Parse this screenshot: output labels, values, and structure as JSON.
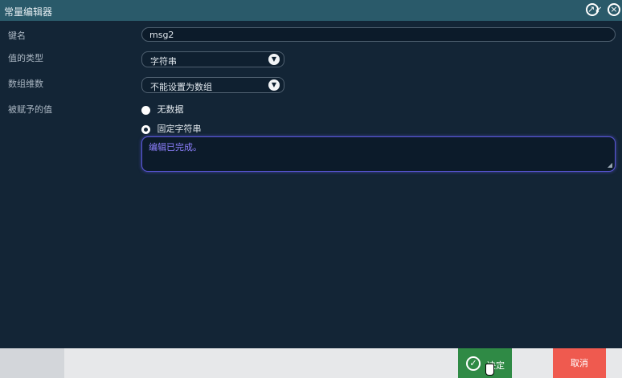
{
  "window": {
    "title": "常量编辑器",
    "restore_icon": "↗↙",
    "close_icon": "×"
  },
  "form": {
    "name_label": "键名",
    "name_value": "msg2",
    "type_label": "值的类型",
    "type_value": "字符串",
    "dimension_label": "数组维数",
    "dimension_value": "不能设置为数组",
    "assigned_value_label": "被赋予的值",
    "radio_no_data": "无数据",
    "radio_fixed_string": "固定字符串",
    "text_value": "编辑已完成。"
  },
  "footer": {
    "ok_label": "决定",
    "cancel_label": "取消"
  },
  "colors": {
    "titlebar": "#2a5a6a",
    "background": "#132536",
    "ok": "#2f8a45",
    "cancel": "#ef5a4f"
  },
  "icons": {
    "window_restore": "compress-icon",
    "window_close": "close-icon",
    "select_caret": "chevron-down-icon",
    "ok": "check-circle-icon",
    "cursor": "hand-pointer-icon"
  }
}
